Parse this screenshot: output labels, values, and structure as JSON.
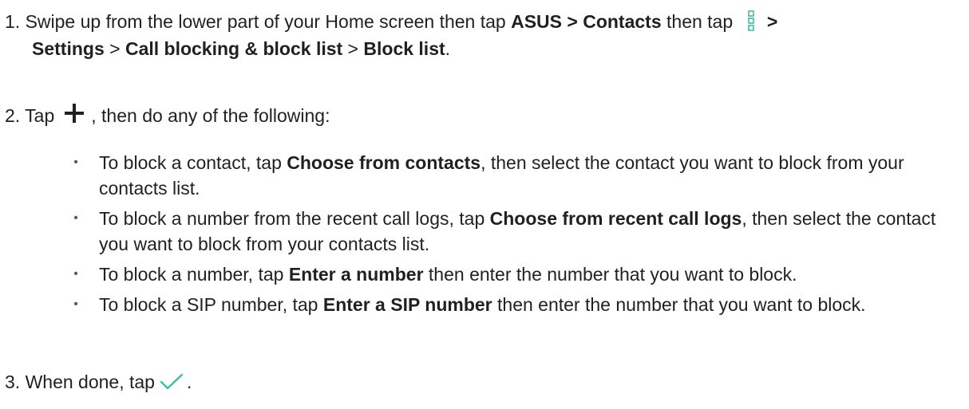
{
  "step1": {
    "number": "1.",
    "text_a": "Swipe up from the lower part of your Home screen then tap ",
    "bold_asus_contacts": "ASUS > Contacts",
    "text_b": " then tap ",
    "bold_gt1": " >",
    "bold_settings": "Settings",
    "sep1": " > ",
    "bold_call_blocking": "Call blocking & block list",
    "sep2": " > ",
    "bold_block_list": "Block list",
    "period": "."
  },
  "step2": {
    "number": "2.",
    "text_a": "Tap",
    "text_b": ", then do any of the following:"
  },
  "bullets": [
    {
      "pre": "To block a contact, tap ",
      "bold": "Choose from contacts",
      "post": ", then select the contact you want to block from your contacts list."
    },
    {
      "pre": "To block a number from the recent call logs, tap ",
      "bold": "Choose from recent call logs",
      "post": ", then select the contact you want to block from your contacts list."
    },
    {
      "pre": "To block a number, tap ",
      "bold": "Enter a number",
      "post": " then enter the number that you want to block."
    },
    {
      "pre": "To block a SIP number, tap ",
      "bold": "Enter a SIP number",
      "post": " then enter the number that you want to block."
    }
  ],
  "step3": {
    "number": "3.",
    "text_a": "When done, tap",
    "text_b": "."
  },
  "icons": {
    "menu": "more-vert-icon",
    "plus": "add-icon",
    "check": "checkmark-icon"
  },
  "colors": {
    "text": "#231f20",
    "menu_icon": "#3bbf9e",
    "check_icon": "#3bbf9e",
    "bullet": "#5a5a5a"
  }
}
